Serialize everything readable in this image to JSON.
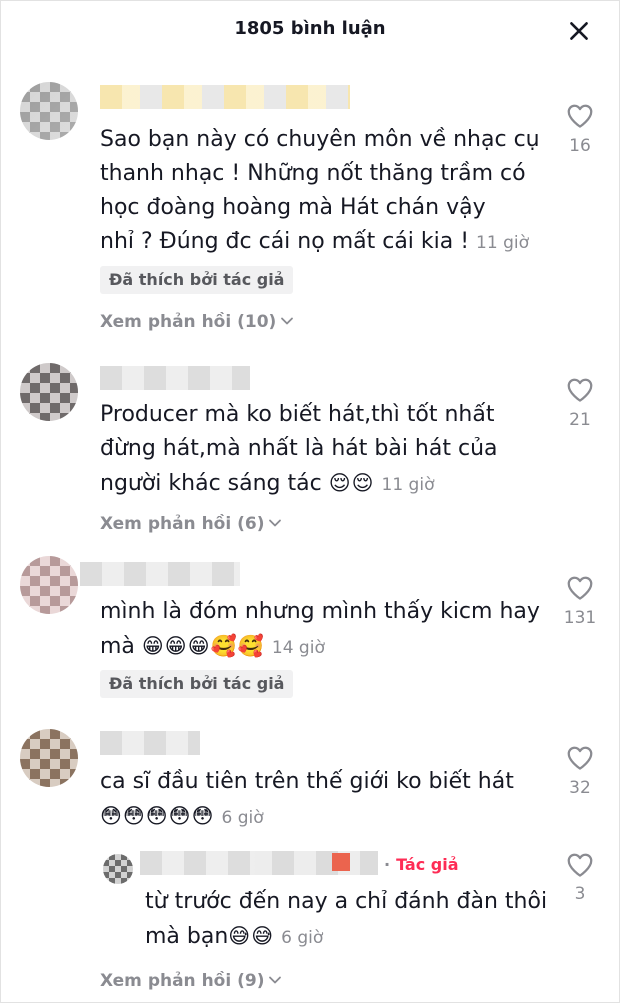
{
  "header": {
    "title": "1805 bình luận",
    "close_icon": "close-icon"
  },
  "comments": [
    {
      "lines": [
        "Sao bạn này có chuyên môn về nhạc cụ",
        "thanh nhạc ! Những nốt thăng trầm có",
        "học đoàng hoàng mà Hát chán vậy",
        "nhỉ ? Đúng đc cái nọ mất cái kia ! "
      ],
      "time": "11 giờ",
      "liked_by_author": "Đã thích bởi tác giả",
      "view_replies": "Xem phản hồi (10)",
      "like_count": "16"
    },
    {
      "lines": [
        "Producer mà ko biết hát,thì tốt nhất",
        "đừng hát,mà nhất là hát bài hát của",
        "người khác sáng tác "
      ],
      "emoji": "😌😌",
      "time": "11 giờ",
      "view_replies": "Xem phản hồi (6)",
      "like_count": "21"
    },
    {
      "lines": [
        "mình là đóm nhưng mình thấy kicm hay",
        "mà "
      ],
      "emoji": "😁😁😁🥰🥰",
      "time": "14 giờ",
      "liked_by_author": "Đã thích bởi tác giả",
      "like_count": "131"
    },
    {
      "lines": [
        "ca sĩ đầu tiên trên thế giới ko biết hát"
      ],
      "emoji": "😳😳😳😳😳",
      "time": "6 giờ",
      "like_count": "32",
      "reply": {
        "author_label": "Tác giả",
        "dot": "·",
        "lines": [
          "từ trước đến nay a chỉ đánh đàn thôi",
          "mà bạn"
        ],
        "emoji": "😅😅",
        "time": "6 giờ",
        "like_count": "3"
      },
      "view_replies": "Xem phản hồi (9)"
    }
  ],
  "icons": {
    "heart": "heart-outline-icon",
    "chevron": "chevron-down-icon"
  },
  "colors": {
    "accent": "#fe2c55",
    "muted": "#8a8b91",
    "text": "#161823"
  }
}
